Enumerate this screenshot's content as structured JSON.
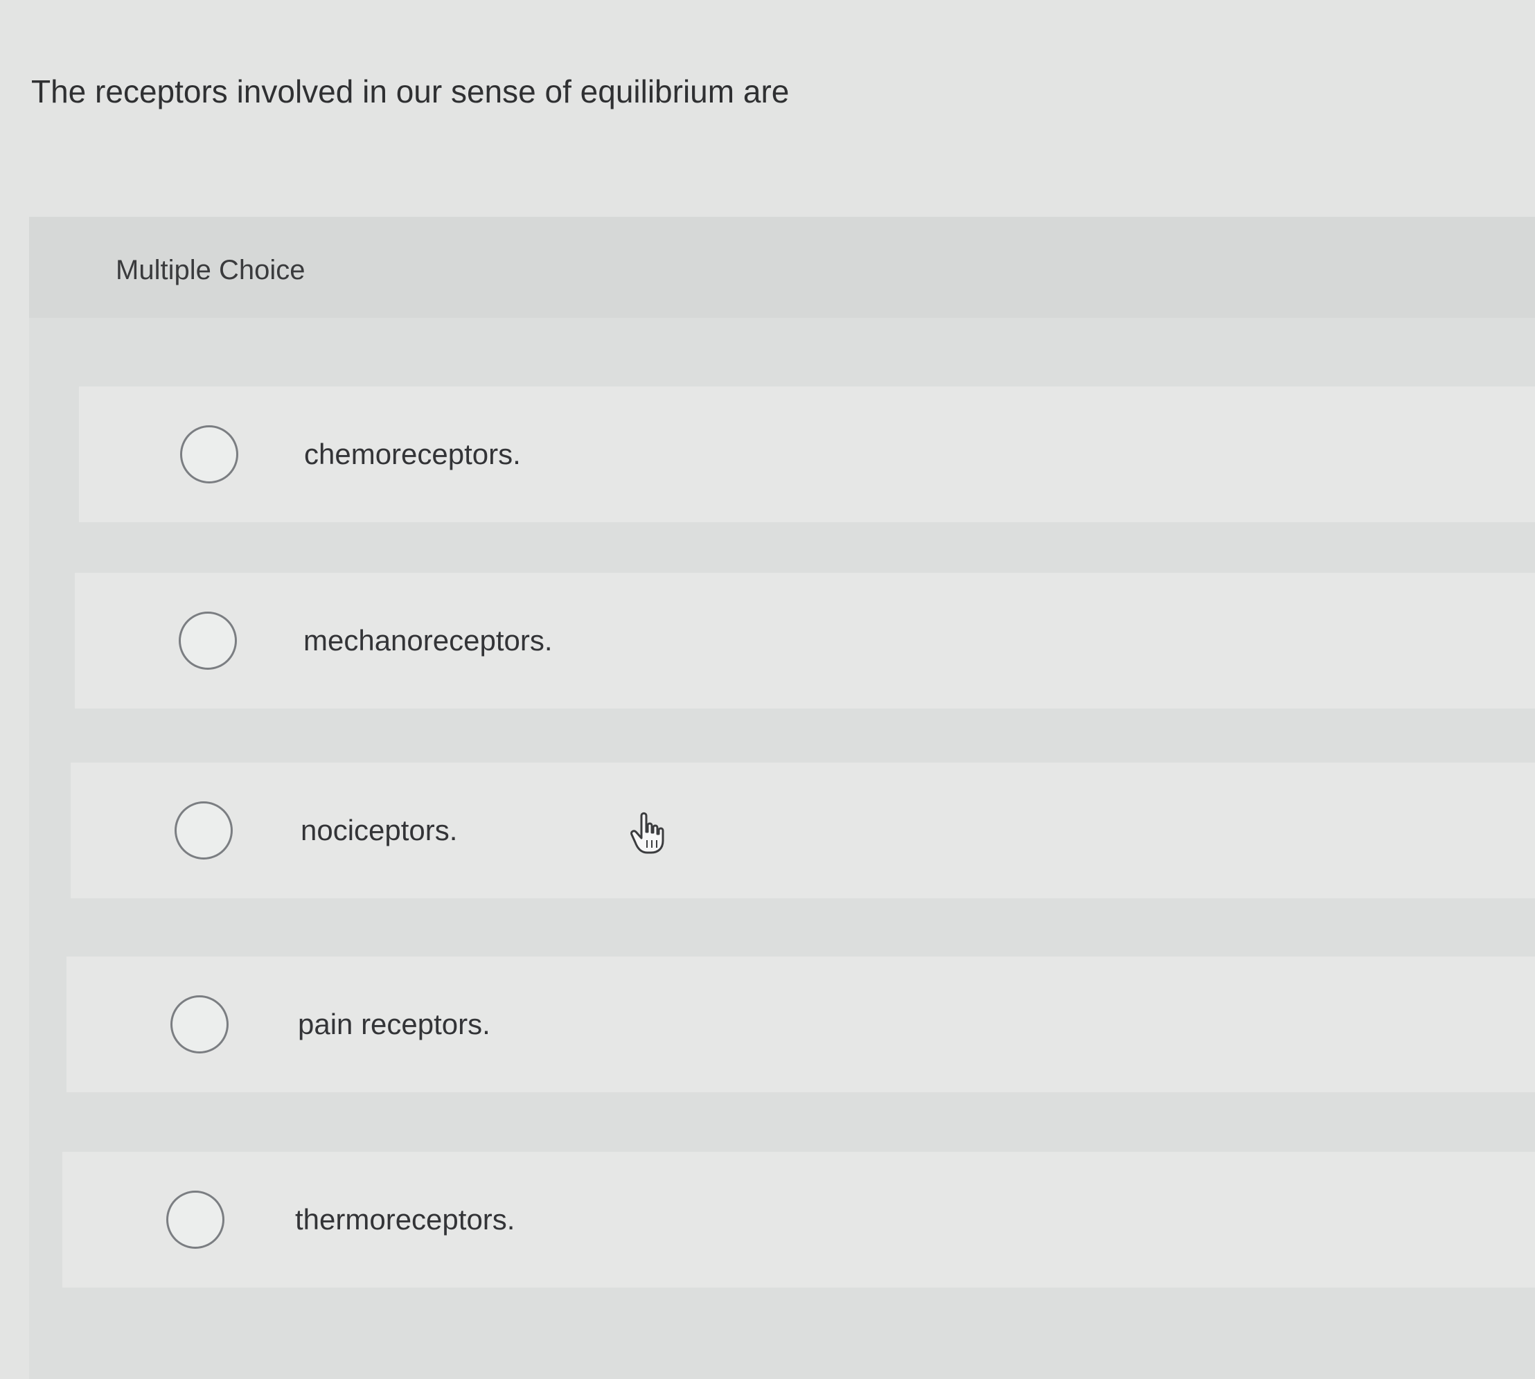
{
  "question": {
    "text": "The receptors involved in our sense of equilibrium are"
  },
  "quiz": {
    "type_label": "Multiple Choice",
    "options": [
      {
        "label": "chemoreceptors.",
        "selected": false
      },
      {
        "label": "mechanoreceptors.",
        "selected": false
      },
      {
        "label": "nociceptors.",
        "selected": false
      },
      {
        "label": "pain receptors.",
        "selected": false
      },
      {
        "label": "thermoreceptors.",
        "selected": false
      }
    ]
  },
  "cursor": {
    "icon": "hand-pointer-icon"
  },
  "colors": {
    "background": "#e3e4e3",
    "panel": "#dcdedd",
    "option_row": "#e6e7e6",
    "radio_border": "#7b7e82",
    "text": "#333437"
  }
}
